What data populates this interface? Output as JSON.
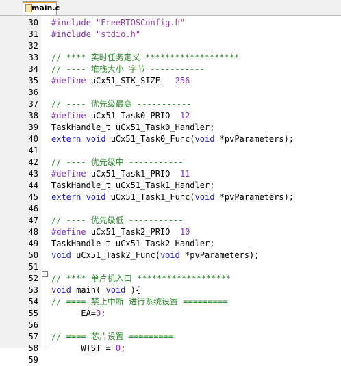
{
  "editor": {
    "tab_label": "main.c",
    "colors": {
      "preprocessor": "#7b2bb8",
      "string": "#9b3fb0",
      "comment": "#2e8b2e",
      "keyword": "#1c1ce0",
      "number": "#8b2ad8",
      "text": "#000000",
      "gutter": "#f0f0f0"
    },
    "lines": [
      {
        "num": "30",
        "tokens": [
          {
            "t": "pp",
            "v": "#include "
          },
          {
            "t": "str",
            "v": "\"FreeRTOSConfig.h\""
          }
        ]
      },
      {
        "num": "31",
        "tokens": [
          {
            "t": "pp",
            "v": "#include "
          },
          {
            "t": "str",
            "v": "\"stdio.h\""
          }
        ]
      },
      {
        "num": "32",
        "tokens": []
      },
      {
        "num": "33",
        "tokens": [
          {
            "t": "cm",
            "v": "// **** 实时任务定义 *******************"
          }
        ]
      },
      {
        "num": "34",
        "tokens": [
          {
            "t": "cm",
            "v": "// ---- 堆栈大小 字节 -----------"
          }
        ]
      },
      {
        "num": "35",
        "tokens": [
          {
            "t": "pp",
            "v": "#define "
          },
          {
            "t": "tx",
            "v": "uCx51_STK_SIZE   "
          },
          {
            "t": "num",
            "v": "256"
          }
        ]
      },
      {
        "num": "36",
        "tokens": []
      },
      {
        "num": "37",
        "tokens": [
          {
            "t": "cm",
            "v": "// ---- 优先级最高 -----------"
          }
        ]
      },
      {
        "num": "38",
        "tokens": [
          {
            "t": "pp",
            "v": "#define "
          },
          {
            "t": "tx",
            "v": "uCx51_Task0_PRIO  "
          },
          {
            "t": "num",
            "v": "12"
          }
        ]
      },
      {
        "num": "39",
        "tokens": [
          {
            "t": "tx",
            "v": "TaskHandle_t uCx51_Task0_Handler;"
          }
        ]
      },
      {
        "num": "40",
        "tokens": [
          {
            "t": "kw",
            "v": "extern "
          },
          {
            "t": "kw",
            "v": "void "
          },
          {
            "t": "tx",
            "v": "uCx51_Task0_Func("
          },
          {
            "t": "kw",
            "v": "void "
          },
          {
            "t": "tx",
            "v": "*pvParameters);"
          }
        ]
      },
      {
        "num": "41",
        "tokens": []
      },
      {
        "num": "42",
        "tokens": [
          {
            "t": "cm",
            "v": "// ---- 优先级中 -----------"
          }
        ]
      },
      {
        "num": "43",
        "tokens": [
          {
            "t": "pp",
            "v": "#define "
          },
          {
            "t": "tx",
            "v": "uCx51_Task1_PRIO  "
          },
          {
            "t": "num",
            "v": "11"
          }
        ]
      },
      {
        "num": "44",
        "tokens": [
          {
            "t": "tx",
            "v": "TaskHandle_t uCx51_Task1_Handler;"
          }
        ]
      },
      {
        "num": "45",
        "tokens": [
          {
            "t": "kw",
            "v": "extern "
          },
          {
            "t": "kw",
            "v": "void "
          },
          {
            "t": "tx",
            "v": "uCx51_Task1_Func("
          },
          {
            "t": "kw",
            "v": "void "
          },
          {
            "t": "tx",
            "v": "*pvParameters);"
          }
        ]
      },
      {
        "num": "46",
        "tokens": []
      },
      {
        "num": "47",
        "tokens": [
          {
            "t": "cm",
            "v": "// ---- 优先级低 -----------"
          }
        ]
      },
      {
        "num": "48",
        "tokens": [
          {
            "t": "pp",
            "v": "#define "
          },
          {
            "t": "tx",
            "v": "uCx51_Task2_PRIO  "
          },
          {
            "t": "num",
            "v": "10"
          }
        ]
      },
      {
        "num": "49",
        "tokens": [
          {
            "t": "tx",
            "v": "TaskHandle_t uCx51_Task2_Handler;"
          }
        ]
      },
      {
        "num": "50",
        "tokens": [
          {
            "t": "kw",
            "v": "void "
          },
          {
            "t": "tx",
            "v": "uCx51_Task2_Func("
          },
          {
            "t": "kw",
            "v": "void "
          },
          {
            "t": "tx",
            "v": "*pvParameters);"
          }
        ]
      },
      {
        "num": "51",
        "tokens": []
      },
      {
        "num": "52",
        "tokens": [
          {
            "t": "cm",
            "v": "// **** 单片机入口 *******************"
          }
        ]
      },
      {
        "num": "53",
        "tokens": [
          {
            "t": "kw",
            "v": "void "
          },
          {
            "t": "tx",
            "v": "main( "
          },
          {
            "t": "kw",
            "v": "void "
          },
          {
            "t": "tx",
            "v": "){"
          }
        ]
      },
      {
        "num": "54",
        "tokens": [
          {
            "t": "cm",
            "v": "// ==== 禁止中断 进行系统设置 ========="
          }
        ]
      },
      {
        "num": "55",
        "tokens": [
          {
            "t": "tx",
            "v": "      EA="
          },
          {
            "t": "num",
            "v": "0"
          },
          {
            "t": "tx",
            "v": ";"
          }
        ]
      },
      {
        "num": "56",
        "tokens": []
      },
      {
        "num": "57",
        "tokens": [
          {
            "t": "cm",
            "v": "// ==== 芯片设置 ========="
          }
        ]
      },
      {
        "num": "58",
        "tokens": [
          {
            "t": "tx",
            "v": "      WTST = "
          },
          {
            "t": "num",
            "v": "0"
          },
          {
            "t": "tx",
            "v": ";"
          }
        ]
      },
      {
        "num": "59",
        "tokens": []
      }
    ]
  }
}
